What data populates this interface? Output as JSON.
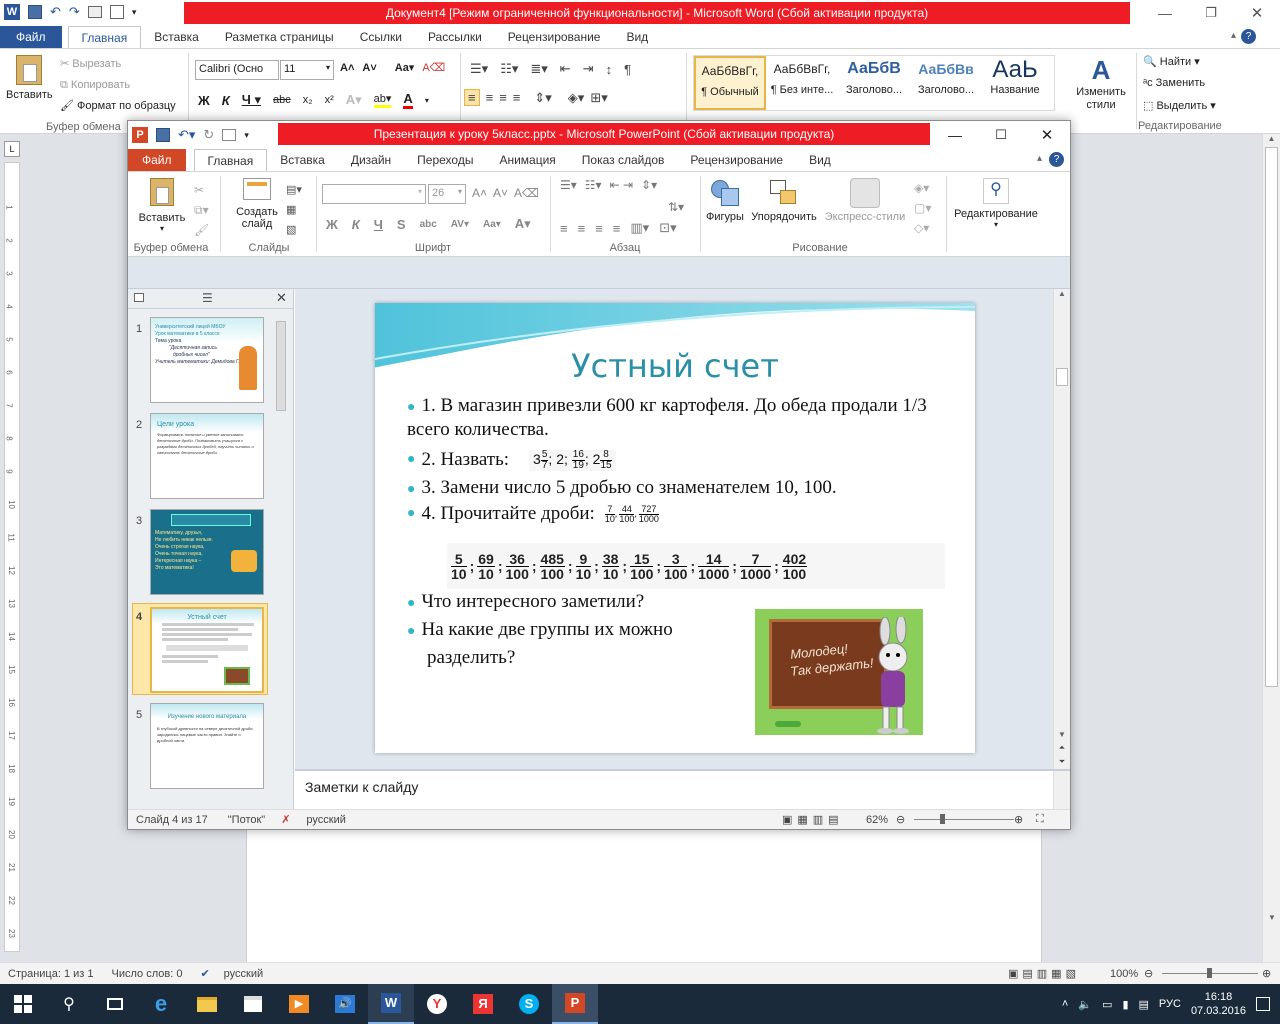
{
  "word": {
    "title": "Документ4 [Режим ограниченной функциональности]  -  Microsoft Word (Сбой активации продукта)",
    "file_tab": "Файл",
    "tabs": [
      "Главная",
      "Вставка",
      "Разметка страницы",
      "Ссылки",
      "Рассылки",
      "Рецензирование",
      "Вид"
    ],
    "clipboard": {
      "paste": "Вставить",
      "cut": "Вырезать",
      "copy": "Копировать",
      "format": "Формат по образцу",
      "group": "Буфер обмена"
    },
    "font_name": "Calibri (Осно",
    "font_size": "11",
    "styles": [
      {
        "preview": "АаБбВвГг,",
        "label": "¶ Обычный"
      },
      {
        "preview": "АаБбВвГг,",
        "label": "¶ Без инте..."
      },
      {
        "preview": "АаБбВ",
        "label": "Заголово..."
      },
      {
        "preview": "АаБбВв",
        "label": "Заголово..."
      },
      {
        "preview": "АаЬ",
        "label": "Название"
      }
    ],
    "change_styles": "Изменить стили",
    "edit": {
      "find": "Найти",
      "replace": "Заменить",
      "select": "Выделить",
      "group": "Редактирование"
    },
    "status": {
      "page": "Страница: 1 из 1",
      "words": "Число слов: 0",
      "lang": "русский",
      "zoom": "100%"
    },
    "ruler_marks": [
      "1",
      "2",
      "3",
      "4",
      "5",
      "6",
      "7",
      "8",
      "9",
      "10",
      "11",
      "12",
      "13",
      "14",
      "15",
      "16",
      "17",
      "18",
      "19",
      "20",
      "21",
      "22",
      "23"
    ]
  },
  "ppt": {
    "title": "Презентация к уроку 5класс.pptx  -  Microsoft PowerPoint (Сбой активации продукта)",
    "file_tab": "Файл",
    "tabs": [
      "Главная",
      "Вставка",
      "Дизайн",
      "Переходы",
      "Анимация",
      "Показ слайдов",
      "Рецензирование",
      "Вид"
    ],
    "ribbon": {
      "paste": "Вставить",
      "clipboard": "Буфер обмена",
      "new_slide": "Создать слайд",
      "slides": "Слайды",
      "font_size": "26",
      "font": "Шрифт",
      "paragraph": "Абзац",
      "shapes": "Фигуры",
      "arrange": "Упорядочить",
      "quick_styles": "Экспресс-стили",
      "drawing": "Рисование",
      "editing": "Редактирование"
    },
    "thumbs": [
      {
        "num": "1",
        "lines": [
          "Университетский лицей МБОУ",
          "Урок математики в 5 классе",
          "Тема урока",
          "\"Десятичная запись",
          "дробных чисел\"",
          "Учитель математики: Демидова Г.В."
        ]
      },
      {
        "num": "2",
        "title": "Цели урока",
        "body": "Формировать понятие и умение записывать десятичные дроби. Познакомить учащихся с разрядами десятичных дробей, научить читать и записывать десятичные дроби."
      },
      {
        "num": "3",
        "lines": [
          "Математику, друзья,",
          "Не любить никак нельзя.",
          "Очень строгая наука,",
          "Очень точная наука,",
          "Интересная наука –",
          "Это математика!"
        ]
      },
      {
        "num": "4",
        "title": "Устный счет"
      },
      {
        "num": "5",
        "title": "Изучение нового материала",
        "body": "В глубокой древности на севере десятичной дроби, зародились лицевые части правил. Знайте о дробной части."
      }
    ],
    "slide": {
      "title": "Устный счет",
      "items": [
        "1. В магазин привезли 600 кг картофеля. До обеда продали 1/3 всего количества.",
        "2. Назвать:",
        "3. Замени число 5 дробью со знаменателем 10, 100.",
        "4. Прочитайте дроби:",
        "Что интересного заметили?",
        "На какие две группы их можно",
        "разделить?"
      ],
      "mixed": [
        {
          "w": "3",
          "n": "5",
          "d": "7"
        },
        {
          "w": "2",
          "n": "",
          "d": ""
        },
        {
          "w": "",
          "n": "16",
          "d": "19"
        },
        {
          "w": "2",
          "n": "8",
          "d": "15"
        }
      ],
      "read_fracs": [
        {
          "n": "7",
          "d": "10"
        },
        {
          "n": "44",
          "d": "100"
        },
        {
          "n": "727",
          "d": "1000"
        }
      ],
      "row_fracs": [
        {
          "n": "5",
          "d": "10"
        },
        {
          "n": "69",
          "d": "10"
        },
        {
          "n": "36",
          "d": "100"
        },
        {
          "n": "485",
          "d": "100"
        },
        {
          "n": "9",
          "d": "10"
        },
        {
          "n": "38",
          "d": "10"
        },
        {
          "n": "15",
          "d": "100"
        },
        {
          "n": "3",
          "d": "100"
        },
        {
          "n": "14",
          "d": "1000"
        },
        {
          "n": "7",
          "d": "1000"
        },
        {
          "n": "402",
          "d": "100"
        }
      ],
      "board_text": [
        "Молодец!",
        "Так держать!"
      ]
    },
    "notes": "Заметки к слайду",
    "status": {
      "slide": "Слайд 4 из 17",
      "theme": "\"Поток\"",
      "lang": "русский",
      "zoom": "62%"
    }
  },
  "taskbar": {
    "time": "16:18",
    "date": "07.03.2016",
    "lang": "РУС"
  }
}
